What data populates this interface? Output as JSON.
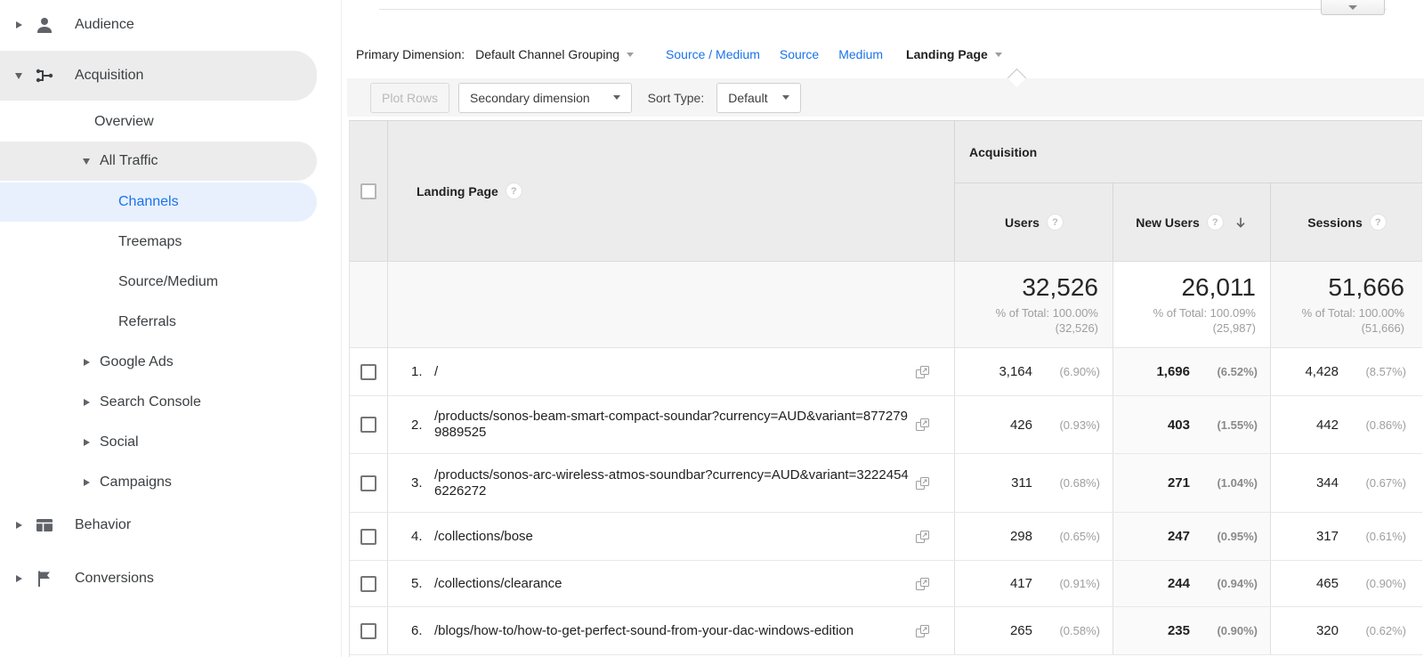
{
  "colors": {
    "accent_blue": "#1a73e8",
    "selected_item_bg": "#e8f0fe",
    "active_item_bg": "#ececec",
    "table_header_bg": "#ececec",
    "toolbar_bg": "#f5f5f5",
    "total_row_bg": "#f8f8f8",
    "sorted_column_bg": "#fafafa"
  },
  "icons": {
    "help_glyph": "?"
  },
  "sidebar": {
    "items": [
      {
        "label": "Audience"
      },
      {
        "label": "Acquisition"
      },
      {
        "label": "Overview"
      },
      {
        "label": "All Traffic"
      },
      {
        "label": "Channels"
      },
      {
        "label": "Treemaps"
      },
      {
        "label": "Source/Medium"
      },
      {
        "label": "Referrals"
      },
      {
        "label": "Google Ads"
      },
      {
        "label": "Search Console"
      },
      {
        "label": "Social"
      },
      {
        "label": "Campaigns"
      },
      {
        "label": "Behavior"
      },
      {
        "label": "Conversions"
      }
    ]
  },
  "primary_dimension": {
    "label": "Primary Dimension:",
    "dropdown": "Default Channel Grouping",
    "links": [
      "Source / Medium",
      "Source",
      "Medium"
    ],
    "active": "Landing Page"
  },
  "toolbar": {
    "plot_rows": "Plot Rows",
    "secondary_dimension": "Secondary dimension",
    "sort_type_label": "Sort Type:",
    "sort_type_value": "Default"
  },
  "table": {
    "dimension_header": "Landing Page",
    "group_header": "Acquisition",
    "columns": [
      "Users",
      "New Users",
      "Sessions"
    ],
    "totals": {
      "users": {
        "value": "32,526",
        "pct": "% of Total: 100.00%",
        "sub": "(32,526)"
      },
      "new_users": {
        "value": "26,011",
        "pct": "% of Total: 100.09%",
        "sub": "(25,987)"
      },
      "sessions": {
        "value": "51,666",
        "pct": "% of Total: 100.00%",
        "sub": "(51,666)"
      }
    },
    "rows": [
      {
        "num": "1.",
        "url": "/",
        "users_v": "3,164",
        "users_p": "(6.90%)",
        "new_v": "1,696",
        "new_p": "(6.52%)",
        "sess_v": "4,428",
        "sess_p": "(8.57%)"
      },
      {
        "num": "2.",
        "url": "/products/sonos-beam-smart-compact-soundar?currency=AUD&variant=8772799889525",
        "users_v": "426",
        "users_p": "(0.93%)",
        "new_v": "403",
        "new_p": "(1.55%)",
        "sess_v": "442",
        "sess_p": "(0.86%)"
      },
      {
        "num": "3.",
        "url": "/products/sonos-arc-wireless-atmos-soundbar?currency=AUD&variant=32224546226272",
        "users_v": "311",
        "users_p": "(0.68%)",
        "new_v": "271",
        "new_p": "(1.04%)",
        "sess_v": "344",
        "sess_p": "(0.67%)"
      },
      {
        "num": "4.",
        "url": "/collections/bose",
        "users_v": "298",
        "users_p": "(0.65%)",
        "new_v": "247",
        "new_p": "(0.95%)",
        "sess_v": "317",
        "sess_p": "(0.61%)"
      },
      {
        "num": "5.",
        "url": "/collections/clearance",
        "users_v": "417",
        "users_p": "(0.91%)",
        "new_v": "244",
        "new_p": "(0.94%)",
        "sess_v": "465",
        "sess_p": "(0.90%)"
      },
      {
        "num": "6.",
        "url": "/blogs/how-to/how-to-get-perfect-sound-from-your-dac-windows-edition",
        "users_v": "265",
        "users_p": "(0.58%)",
        "new_v": "235",
        "new_p": "(0.90%)",
        "sess_v": "320",
        "sess_p": "(0.62%)"
      }
    ]
  }
}
